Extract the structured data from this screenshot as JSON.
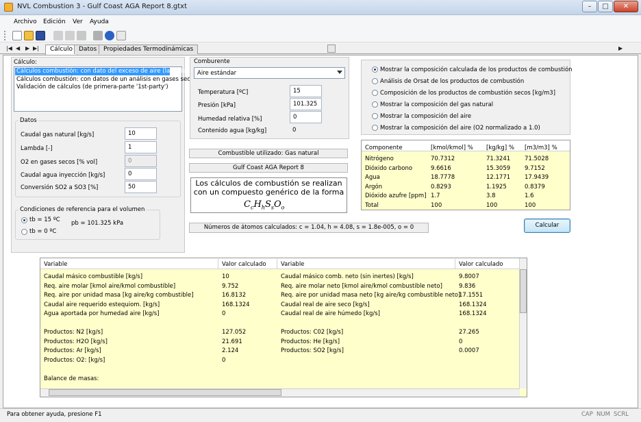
{
  "window": {
    "title": "NVL Combustion 3 - Gulf Coast AGA Report 8.gtxt",
    "min": "–",
    "max": "□",
    "close": "✕"
  },
  "menu": [
    "Archivo",
    "Edición",
    "Ver",
    "Ayuda"
  ],
  "toolbar_icons": [
    "new-icon",
    "open-icon",
    "save-icon",
    "cut-icon",
    "copy-icon",
    "paste-icon",
    "print-icon",
    "about-icon",
    "help-icon"
  ],
  "colors": {
    "selected": "#3399ff",
    "results_bg": "#ffffcc"
  },
  "tabs": {
    "nav": [
      "|◀",
      "◀",
      "▶",
      "▶|"
    ],
    "items": [
      "Cálculo",
      "Datos",
      "Propiedades Termodinámicas"
    ],
    "active": "Cálculo",
    "nav_right": "▶"
  },
  "calculo": {
    "title": "Cálculo:",
    "options": [
      "Cálculos combustión: con dato del exceso de aire (lambda)",
      "Cálculos combustión: con datos de un análisis en gases secos",
      "Validación de cálculos (de primera-parte '1st-party')"
    ],
    "selected": 0
  },
  "datos": {
    "title": "Datos",
    "fields": [
      {
        "label": "Caudal gas natural [kg/s]",
        "value": "10"
      },
      {
        "label": "Lambda [-]",
        "value": "1"
      },
      {
        "label": "O2 en gases secos [% vol]",
        "value": "0",
        "disabled": true
      },
      {
        "label": "Caudal agua inyección [kg/s]",
        "value": "0"
      },
      {
        "label": "Conversión SO2 a SO3 [%]",
        "value": "50"
      }
    ]
  },
  "referencia": {
    "title": "Condiciones de referencia para el volumen",
    "options": [
      "tb = 15 ºC",
      "tb = 0 ºC"
    ],
    "selected": 0,
    "pb": "pb = 101.325 kPa"
  },
  "comburente": {
    "title": "Comburente",
    "select": "Aire estándar",
    "fields": [
      {
        "label": "Temperatura [ºC]",
        "value": "15"
      },
      {
        "label": "Presión [kPa]",
        "value": "101.325"
      },
      {
        "label": "Humedad relativa [%]",
        "value": "0"
      },
      {
        "label": "Contenido agua [kg/kg]",
        "value": "0"
      }
    ]
  },
  "fuel_used": "Combustible utilizado: Gas natural",
  "report_name": "Gulf Coast AGA Report 8",
  "formula": {
    "text": "Los cálculos de combustión se realizan con un compuesto genérico de la forma",
    "expr": "CcHhSsOo"
  },
  "atoms": "Números de átomos calculados: c = 1.04, h = 4.08, s = 1.8e-005, o = 0",
  "view_options": {
    "items": [
      "Mostrar la composición calculada de los productos de combustión",
      "Análisis de Orsat de los productos de combustión",
      "Composición de los productos de combustión secos [kg/m3]",
      "Mostrar la composición del gas natural",
      "Mostrar la composición del aire",
      "Mostrar la composición del aire (O2 normalizado a 1.0)"
    ],
    "selected": 0
  },
  "composition": {
    "headers": [
      "Componente",
      "[kmol/kmol]  %",
      "[kg/kg]  %",
      "[m3/m3]  %"
    ],
    "rows": [
      [
        "Nitrógeno",
        "70.7312",
        "71.3241",
        "71.5028"
      ],
      [
        "Dióxido carbono",
        "9.6616",
        "15.3059",
        "9.7152"
      ],
      [
        "Agua",
        "18.7778",
        "12.1771",
        "17.9439"
      ],
      [
        "Argón",
        "0.8293",
        "1.1925",
        "0.8379"
      ],
      [
        "Dióxido azufre [ppm]",
        "1.7",
        "3.8",
        "1.6"
      ],
      [
        "Total",
        "100",
        "100",
        "100"
      ]
    ]
  },
  "calcular": "Calcular",
  "results": {
    "headers": [
      "Variable",
      "Valor calculado",
      "Variable",
      "Valor calculado"
    ],
    "rows": [
      [
        "Caudal másico combustible [kg/s]",
        "10",
        "Caudal másico comb. neto (sin inertes) [kg/s]",
        "9.8007"
      ],
      [
        "Req. aire molar [kmol aire/kmol combustible]",
        "9.752",
        "Req. aire molar neto [kmol aire/kmol combustible neto]",
        "9.836"
      ],
      [
        "Req. aire por unidad masa [kg aire/kg combustible]",
        "16.8132",
        "Req. aire por unidad masa neto [kg aire/kg combustible neto]",
        "17.1551"
      ],
      [
        "Caudal aire requerido estequiom. [kg/s]",
        "168.1324",
        "Caudal real de aire seco [kg/s]",
        "168.1324"
      ],
      [
        "Agua aportada por humedad aire [kg/s]",
        "0",
        "Caudal real de aire húmedo [kg/s]",
        "168.1324"
      ],
      [
        "",
        "",
        "",
        ""
      ],
      [
        "Productos: N2 [kg/s]",
        "127.052",
        "Productos: C02 [kg/s]",
        "27.265"
      ],
      [
        "Productos: H2O [kg/s]",
        "21.691",
        "Productos: He [kg/s]",
        "0"
      ],
      [
        "Productos: Ar [kg/s]",
        "2.124",
        "Productos: SO2 [kg/s]",
        "0.0007"
      ],
      [
        "Productos: O2: [kg/s]",
        "0",
        "",
        ""
      ],
      [
        "",
        "",
        "",
        ""
      ],
      [
        "Balance de masas:",
        "",
        "",
        ""
      ]
    ]
  },
  "status": {
    "text": "Para obtener ayuda, presione F1",
    "indicators": [
      "CAP",
      "NUM",
      "SCRL"
    ]
  }
}
